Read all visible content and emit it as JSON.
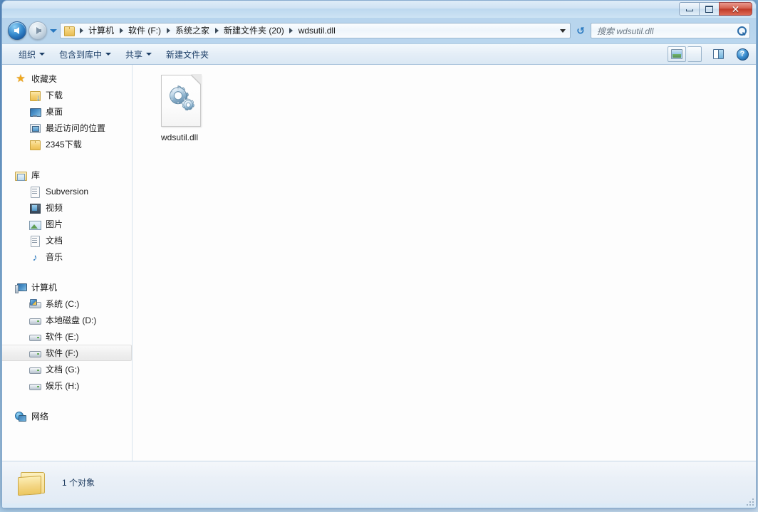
{
  "window": {
    "controls": {
      "minimize": "—",
      "maximize": "❐",
      "close": "✕"
    }
  },
  "navigation": {
    "back_title": "后退",
    "forward_title": "前进",
    "history_dropdown": "▾",
    "refresh": "↻"
  },
  "address": {
    "crumbs": [
      "计算机",
      "软件 (F:)",
      "系统之家",
      "新建文件夹 (20)",
      "wdsutil.dll"
    ],
    "dropdown": "▾"
  },
  "search": {
    "placeholder": "搜索 wdsutil.dll",
    "value": ""
  },
  "toolbar": {
    "items": [
      {
        "label": "组织",
        "has_caret": true
      },
      {
        "label": "包含到库中",
        "has_caret": true
      },
      {
        "label": "共享",
        "has_caret": true
      },
      {
        "label": "新建文件夹",
        "has_caret": false
      }
    ],
    "views_label": "更改您的视图",
    "views_caret": "▾",
    "preview_label": "显示预览窗格",
    "help_label": "?"
  },
  "sidebar": {
    "groups": [
      {
        "header": {
          "label": "收藏夹",
          "icon": "star-icon"
        },
        "items": [
          {
            "label": "下载",
            "icon": "downloads-icon",
            "selected": false
          },
          {
            "label": "桌面",
            "icon": "desktop-icon",
            "selected": false
          },
          {
            "label": "最近访问的位置",
            "icon": "recent-places-icon",
            "selected": false
          },
          {
            "label": "2345下载",
            "icon": "folder-icon",
            "selected": false
          }
        ]
      },
      {
        "header": {
          "label": "库",
          "icon": "library-icon"
        },
        "items": [
          {
            "label": "Subversion",
            "icon": "document-icon",
            "selected": false
          },
          {
            "label": "视频",
            "icon": "video-icon",
            "selected": false
          },
          {
            "label": "图片",
            "icon": "pictures-icon",
            "selected": false
          },
          {
            "label": "文档",
            "icon": "document-icon",
            "selected": false
          },
          {
            "label": "音乐",
            "icon": "music-icon",
            "selected": false
          }
        ]
      },
      {
        "header": {
          "label": "计算机",
          "icon": "computer-icon"
        },
        "items": [
          {
            "label": "系统 (C:)",
            "icon": "system-drive-icon",
            "selected": false
          },
          {
            "label": "本地磁盘 (D:)",
            "icon": "drive-icon",
            "selected": false
          },
          {
            "label": "软件 (E:)",
            "icon": "drive-icon",
            "selected": false
          },
          {
            "label": "软件 (F:)",
            "icon": "drive-icon",
            "selected": true
          },
          {
            "label": "文档 (G:)",
            "icon": "drive-icon",
            "selected": false
          },
          {
            "label": "娱乐 (H:)",
            "icon": "drive-icon",
            "selected": false
          }
        ]
      },
      {
        "header": {
          "label": "网络",
          "icon": "network-icon"
        },
        "items": []
      }
    ]
  },
  "files": [
    {
      "name": "wdsutil.dll",
      "icon": "dll-file-icon",
      "selected": false
    }
  ],
  "statusbar": {
    "text": "1 个对象",
    "icon": "open-folder-icon"
  },
  "colors": {
    "accent": "#2878c0",
    "titlebar": "#bcd8ef",
    "close_button": "#bf3a28",
    "folder_yellow": "#ecbe52",
    "content_bg": "#fdfdfd"
  }
}
